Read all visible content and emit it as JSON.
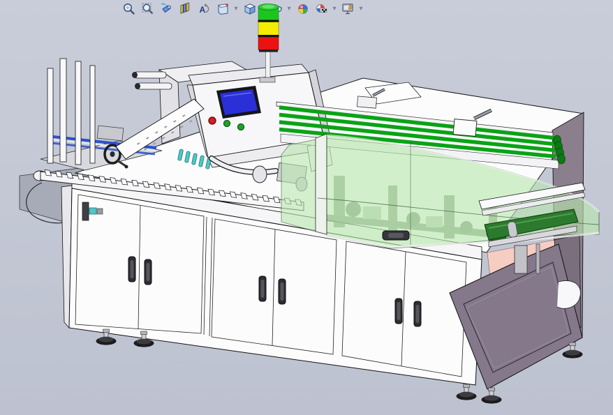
{
  "viewport": {
    "background_top": "#c9cdd9",
    "background_bottom": "#bdc2d0"
  },
  "toolbar": {
    "items": [
      {
        "name": "zoom-to-fit",
        "dropdown": false
      },
      {
        "name": "zoom-to-area",
        "dropdown": false
      },
      {
        "name": "previous-view",
        "dropdown": false
      },
      {
        "name": "section-view",
        "dropdown": false
      },
      {
        "name": "annotation-views",
        "dropdown": false
      },
      {
        "name": "view-orientation",
        "dropdown": true
      },
      {
        "name": "display-style",
        "dropdown": true
      },
      {
        "name": "hide-show-items",
        "dropdown": true
      },
      {
        "name": "edit-appearance",
        "dropdown": false
      },
      {
        "name": "apply-scene",
        "dropdown": true
      },
      {
        "name": "view-settings",
        "dropdown": true
      }
    ],
    "dropdown_glyph": "▾"
  },
  "scene": {
    "model": "cartoning-machine-3d-model",
    "stack_light": {
      "segments": [
        {
          "position": "top",
          "color": "#1ec51e"
        },
        {
          "position": "middle",
          "color": "#f6ec00"
        },
        {
          "position": "bottom",
          "color": "#ec1212"
        }
      ]
    },
    "hmi": {
      "screen_color": "#2a2fd8",
      "buttons": [
        {
          "color": "#d42020"
        },
        {
          "color": "#1ea32a"
        },
        {
          "color": "#1ea32a"
        }
      ]
    },
    "colors": {
      "machine_white": "#fcfcfd",
      "guard_glass_green": "#b9e8ae",
      "conveyor_green": "#0aa316",
      "belt_dark_green": "#2c7a2e",
      "end_panel_mauve": "#8b7f8e",
      "column_mauve": "#84788a",
      "inner_panel_pink": "#f6cdc3",
      "suction_teal": "#52c6c6",
      "frame_blue": "#2a52cc",
      "handle_dark": "#2e2e32"
    }
  }
}
